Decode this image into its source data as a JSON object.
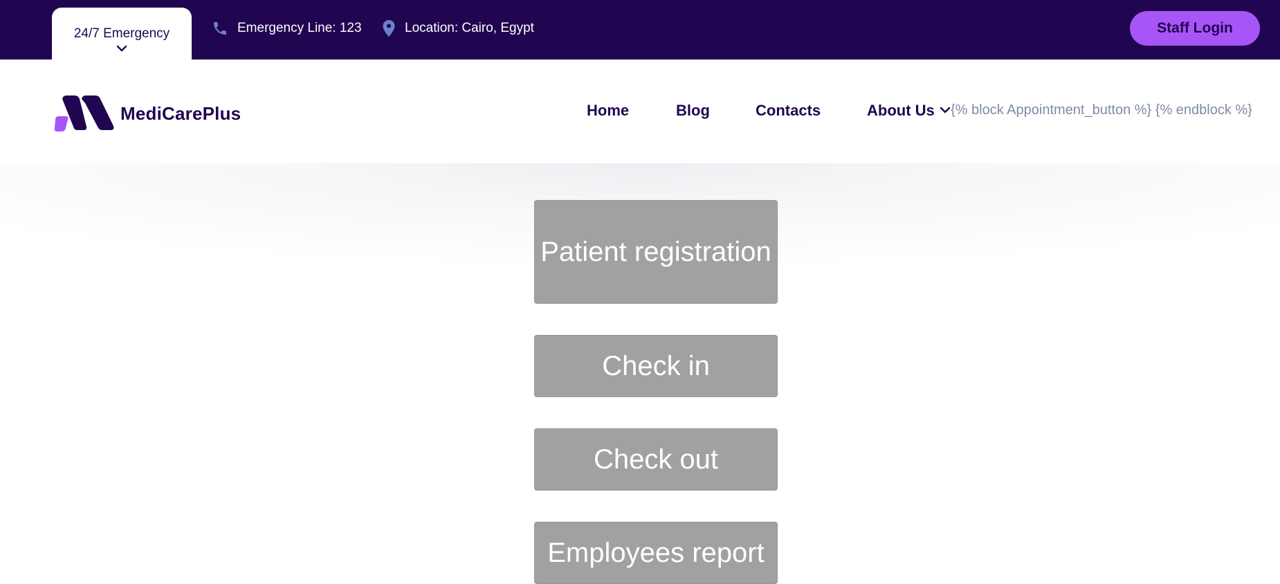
{
  "topbar": {
    "emergency_label": "24/7 Emergency",
    "phone_text": "Emergency Line: 123",
    "location_text": "Location: Cairo, Egypt",
    "staff_login": "Staff Login"
  },
  "header": {
    "logo_text": "MediCarePlus",
    "nav": {
      "home": "Home",
      "blog": "Blog",
      "contacts": "Contacts",
      "about": "About Us"
    },
    "template_placeholder": "{% block Appointment_button %} {% endblock %}"
  },
  "main": {
    "buttons": [
      "Patient registration",
      "Check in",
      "Check out",
      "Employees report"
    ]
  },
  "colors": {
    "topbar_bg": "#200650",
    "accent": "#a855f7",
    "button_bg": "#a1a1a1",
    "text_dark": "#200650"
  },
  "icons": [
    "chevron-down-icon",
    "phone-icon",
    "location-pin-icon",
    "logo-icon"
  ]
}
